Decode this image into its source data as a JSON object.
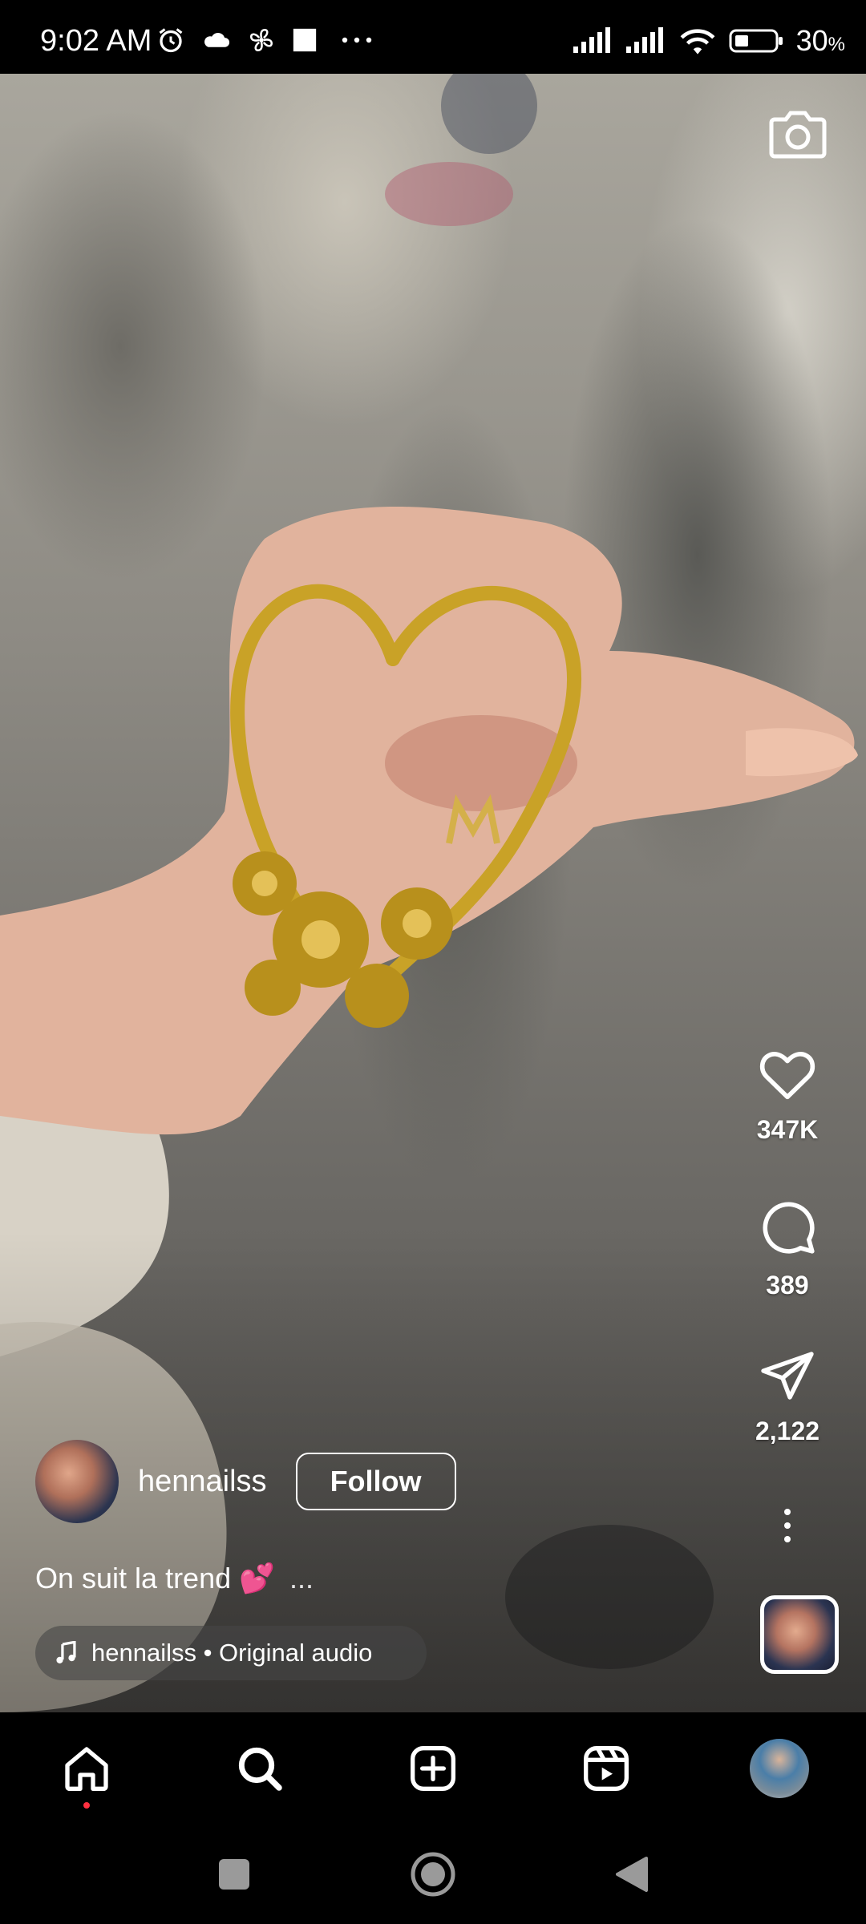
{
  "status_bar": {
    "time": "9:02 AM",
    "battery_percent": "30",
    "battery_suffix": "%"
  },
  "post": {
    "username": "hennailss",
    "follow_label": "Follow",
    "caption": "On suit la trend",
    "caption_emoji": "💕",
    "more_label": "...",
    "audio": "hennailss • Original audio"
  },
  "actions": {
    "likes": "347K",
    "comments": "389",
    "shares": "2,122"
  },
  "nav": {
    "items": [
      "home-icon",
      "search-icon",
      "create-icon",
      "reels-icon",
      "profile-avatar"
    ],
    "active": "home"
  },
  "colors": {
    "accent_dot": "#ff3040",
    "henna_gold": "#c9a227"
  }
}
